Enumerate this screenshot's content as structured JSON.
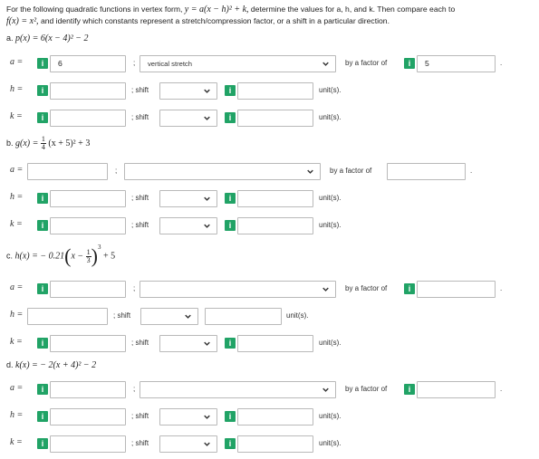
{
  "instructions": {
    "line1": "For the following quadratic functions in vertex form,",
    "eq1": "y = a(x − h)² + k,",
    "line1b": "determine the values for a, h, and k. Then compare each to",
    "eq2": "f(x) = x²,",
    "line2b": "and identify which constants represent a stretch/compression factor, or a shift in a particular direction."
  },
  "parts": {
    "a": {
      "label": "a.",
      "func": "p(x) = 6(x − 4)² − 2"
    },
    "b": {
      "label": "b.",
      "func_prefix": "g(x) =",
      "frac_num": "1",
      "frac_den": "4",
      "func_suffix": "(x + 5)² + 3"
    },
    "c": {
      "label": "c.",
      "func_prefix": "h(x) = − 0.21",
      "inner": "x −",
      "frac_num": "1",
      "frac_den": "3",
      "exp": "3",
      "func_suffix": "+ 5"
    },
    "d": {
      "label": "d.",
      "func": "k(x) = − 2(x + 4)² − 2"
    }
  },
  "labels": {
    "a_eq": "a =",
    "h_eq": "h =",
    "k_eq": "k =",
    "semicolon": ";",
    "shift": "; shift",
    "units": "unit(s).",
    "by_factor": "by a factor of",
    "period": "."
  },
  "values": {
    "pa_a": "6",
    "pa_stretch": "vertical stretch",
    "pa_factor": "5"
  },
  "icons": {
    "info": "i"
  }
}
